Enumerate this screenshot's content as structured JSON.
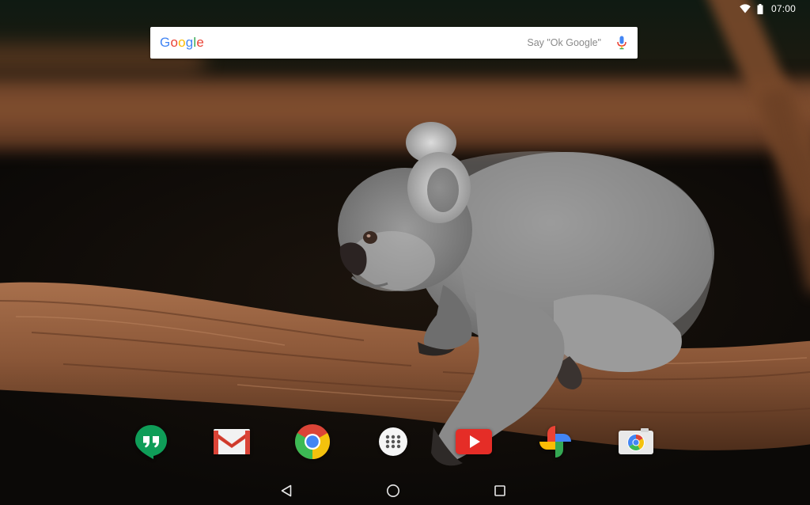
{
  "status_bar": {
    "time": "07:00",
    "wifi_icon": "wifi-icon",
    "battery_icon": "battery-icon"
  },
  "search": {
    "logo_letters": [
      {
        "char": "G",
        "color": "#4285F4"
      },
      {
        "char": "o",
        "color": "#EA4335"
      },
      {
        "char": "o",
        "color": "#FBBC05"
      },
      {
        "char": "g",
        "color": "#4285F4"
      },
      {
        "char": "l",
        "color": "#34A853"
      },
      {
        "char": "e",
        "color": "#EA4335"
      }
    ],
    "hint": "Say \"Ok Google\"",
    "mic_icon": "mic-icon"
  },
  "dock": {
    "apps": [
      {
        "id": "hangouts",
        "icon": "hangouts-icon"
      },
      {
        "id": "gmail",
        "icon": "gmail-icon"
      },
      {
        "id": "chrome",
        "icon": "chrome-icon"
      },
      {
        "id": "app-drawer",
        "icon": "app-drawer-icon"
      },
      {
        "id": "youtube",
        "icon": "youtube-icon"
      },
      {
        "id": "photos",
        "icon": "photos-icon"
      },
      {
        "id": "camera",
        "icon": "camera-icon"
      }
    ]
  },
  "nav": {
    "back_icon": "back-icon",
    "home_icon": "home-icon",
    "recents_icon": "recents-icon"
  },
  "wallpaper": {
    "subject": "koala-on-branch"
  },
  "colors": {
    "hangouts": "#0F9D58",
    "gmail": "#DB4437",
    "youtube": "#E52D27",
    "chrome_red": "#DB4437",
    "chrome_yellow": "#F4C20D",
    "chrome_green": "#3CBA54",
    "chrome_blue": "#4285F4"
  }
}
